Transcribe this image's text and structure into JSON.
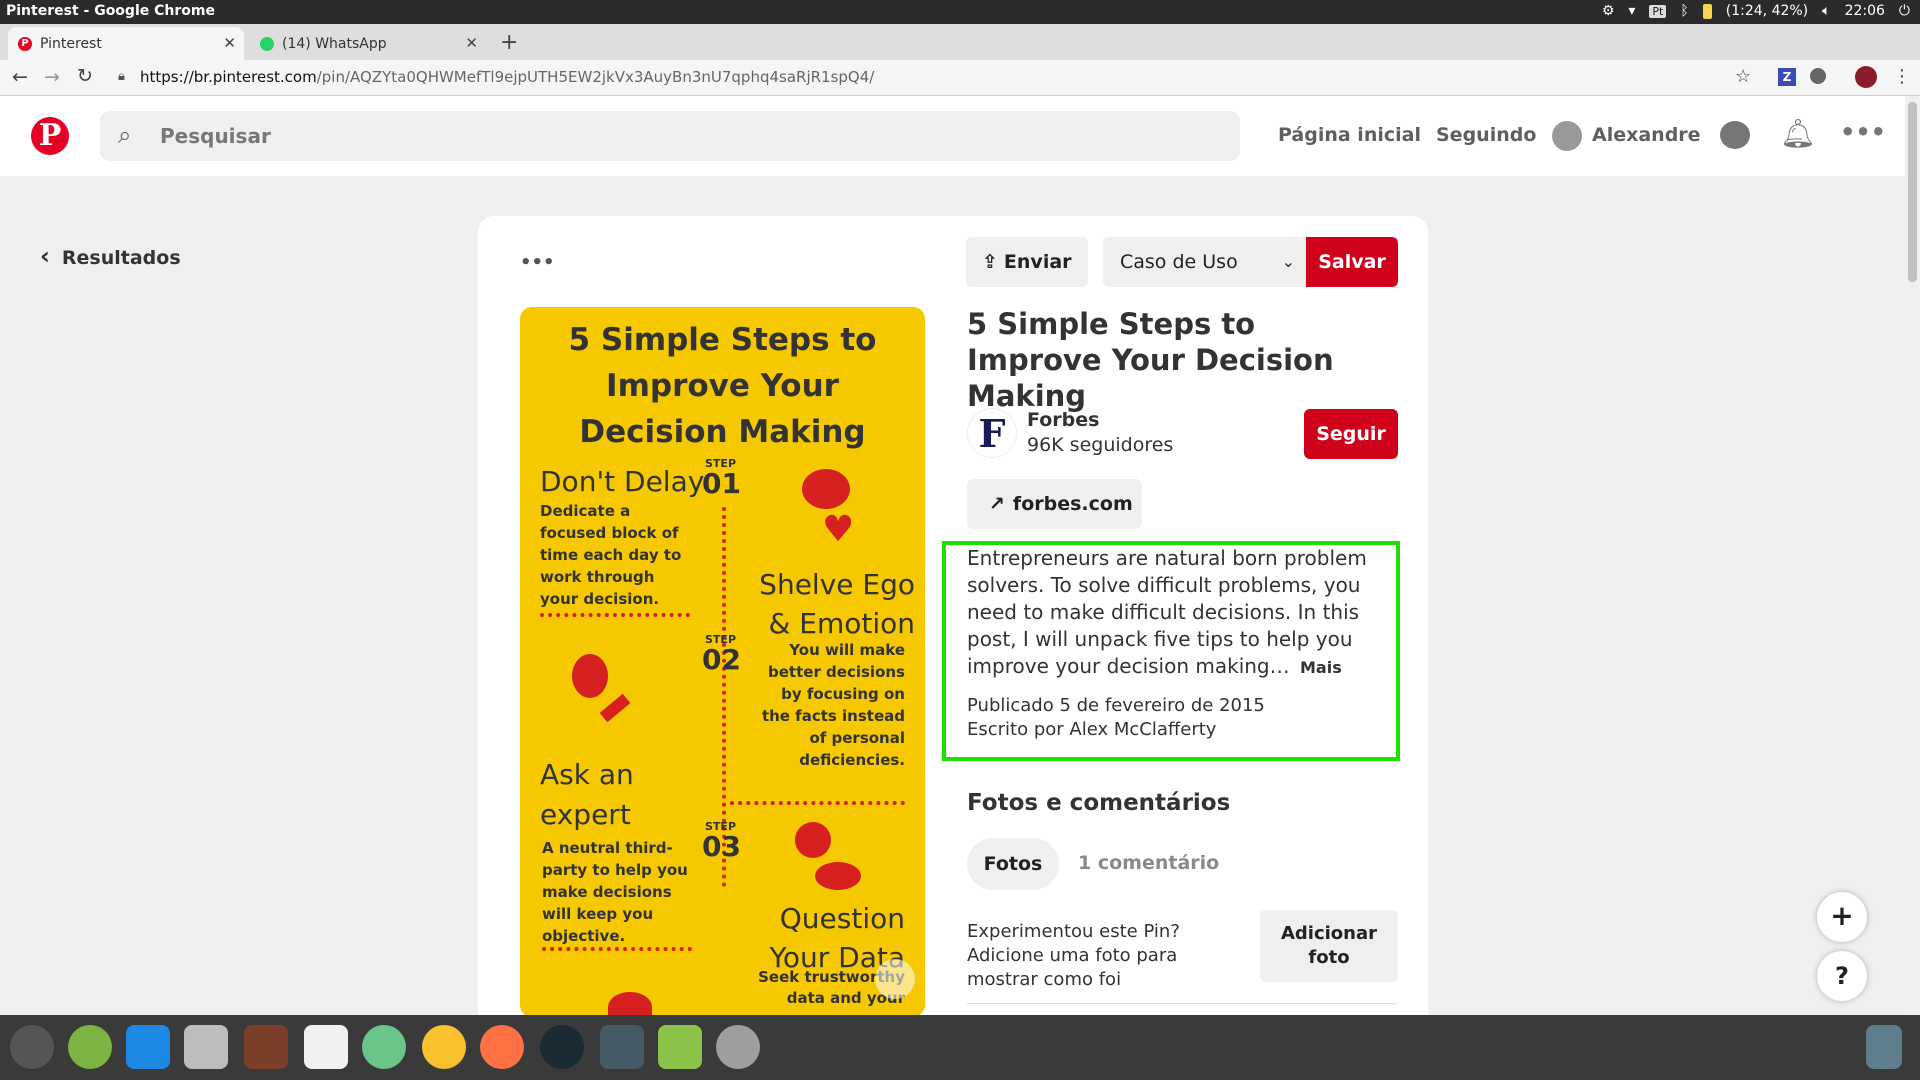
{
  "window": {
    "title": "Pinterest - Google Chrome",
    "tray_status": "(1:24, 42%)",
    "time": "22:06",
    "lang": "Pt"
  },
  "tabs": [
    {
      "label": "Pinterest",
      "icon": "pinterest-icon"
    },
    {
      "label": "(14) WhatsApp",
      "icon": "whatsapp-icon"
    }
  ],
  "address": {
    "host": "https://br.pinterest.com",
    "path": "/pin/AQZYta0QHWMefTl9ejpUTH5EW2jkVx3AuyBn3nU7qphq4saRjR1spQ4/"
  },
  "header": {
    "logo": "P",
    "search_placeholder": "Pesquisar",
    "nav": {
      "home": "Página inicial",
      "following": "Seguindo",
      "user": "Alexandre"
    }
  },
  "back_label": "Resultados",
  "pin": {
    "more": "•••",
    "send_label": "Enviar",
    "board_select": "Caso de Uso",
    "save_label": "Salvar",
    "title": "5 Simple Steps to Improve Your Decision Making",
    "source": {
      "name": "Forbes",
      "followers": "96K seguidores",
      "follow_label": "Seguir",
      "logo": "F"
    },
    "link_label": "forbes.com",
    "description": "Entrepreneurs are natural born problem solvers. To solve difficult problems, you need to make difficult decisions. In this post, I will unpack five tips to help you improve your decision making…",
    "more_label": "Mais",
    "published": "Publicado 5 de fevereiro de 2015",
    "author": "Escrito por Alex McClafferty",
    "comments_title": "Fotos e comentários",
    "tab_photos": "Fotos",
    "tab_comments": "1 comentário",
    "tried_text": "Experimentou este Pin? Adicione uma foto para mostrar como foi",
    "add_photo_label": "Adicionar foto"
  },
  "infographic": {
    "title": "5 Simple Steps to Improve Your Decision Making",
    "step1_label": "STEP",
    "step1_num": "01",
    "step1_title": "Don't Delay",
    "step1_text": "Dedicate a focused block of time each day to work through your decision.",
    "step2_label": "STEP",
    "step2_num": "02",
    "step2_title": "Shelve Ego & Emotion",
    "step2_text": "You will make better decisions by focusing on the facts instead of personal deficiencies.",
    "step3_label": "STEP",
    "step3_num": "03",
    "step3_title": "Ask an expert",
    "step3_text": "A neutral third-party to help you make decisions will keep you objective.",
    "step4_title": "Question Your Data",
    "step4_text": "Seek trustworthy data and your"
  },
  "floating": {
    "plus": "+",
    "help": "?"
  },
  "colors": {
    "pinterest_red": "#e60023",
    "save_red": "#d0021b",
    "highlight_green": "#1fe000",
    "infographic_yellow": "#f5c800"
  }
}
